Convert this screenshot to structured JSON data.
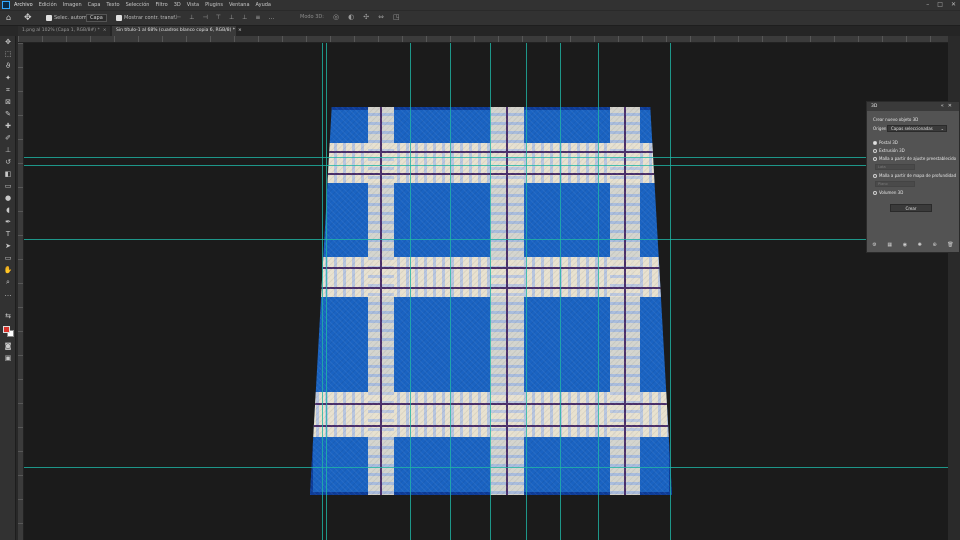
{
  "menu": {
    "items": [
      "Archivo",
      "Edición",
      "Imagen",
      "Capa",
      "Texto",
      "Selección",
      "Filtro",
      "3D",
      "Vista",
      "Plugins",
      "Ventana",
      "Ayuda"
    ]
  },
  "window_controls": [
    "–",
    "□",
    "✕"
  ],
  "options": {
    "auto_select_label": "Selec. autom.:",
    "auto_select_dropdown": "Capa",
    "show_transform_label": "Mostrar contr. transf.",
    "mode_3d_label": "Modo 3D:"
  },
  "tabs": [
    {
      "label": "1.png al 102% (Capa 1, RGB/8#) *",
      "close": "×"
    },
    {
      "label": "Sin título-1 al 68% (cuadros blanco copia 6, RGB/8) *",
      "close": "×"
    }
  ],
  "panel_3d": {
    "title": "3D",
    "create_new_object": "Crear nuevo objeto 3D",
    "source_label": "Origen:",
    "source_value": "Capas seleccionadas",
    "options": [
      {
        "label": "Postal 3D",
        "selected": true
      },
      {
        "label": "Extrusión 3D",
        "selected": false
      },
      {
        "label": "Malla a partir de ajuste preestablecido",
        "selected": false
      },
      {
        "label": "Malla a partir de mapa de profundidad",
        "selected": false
      },
      {
        "label": "Volumen 3D",
        "selected": false
      }
    ],
    "preset_placeholder": "Lata",
    "depth_placeholder": "Plano",
    "create_button": "Crear"
  },
  "colors": {
    "foreground": "#d9332b",
    "background": "#ffffff",
    "guide": "#1fb5a5",
    "fabric_blue": "#1a63c2"
  }
}
